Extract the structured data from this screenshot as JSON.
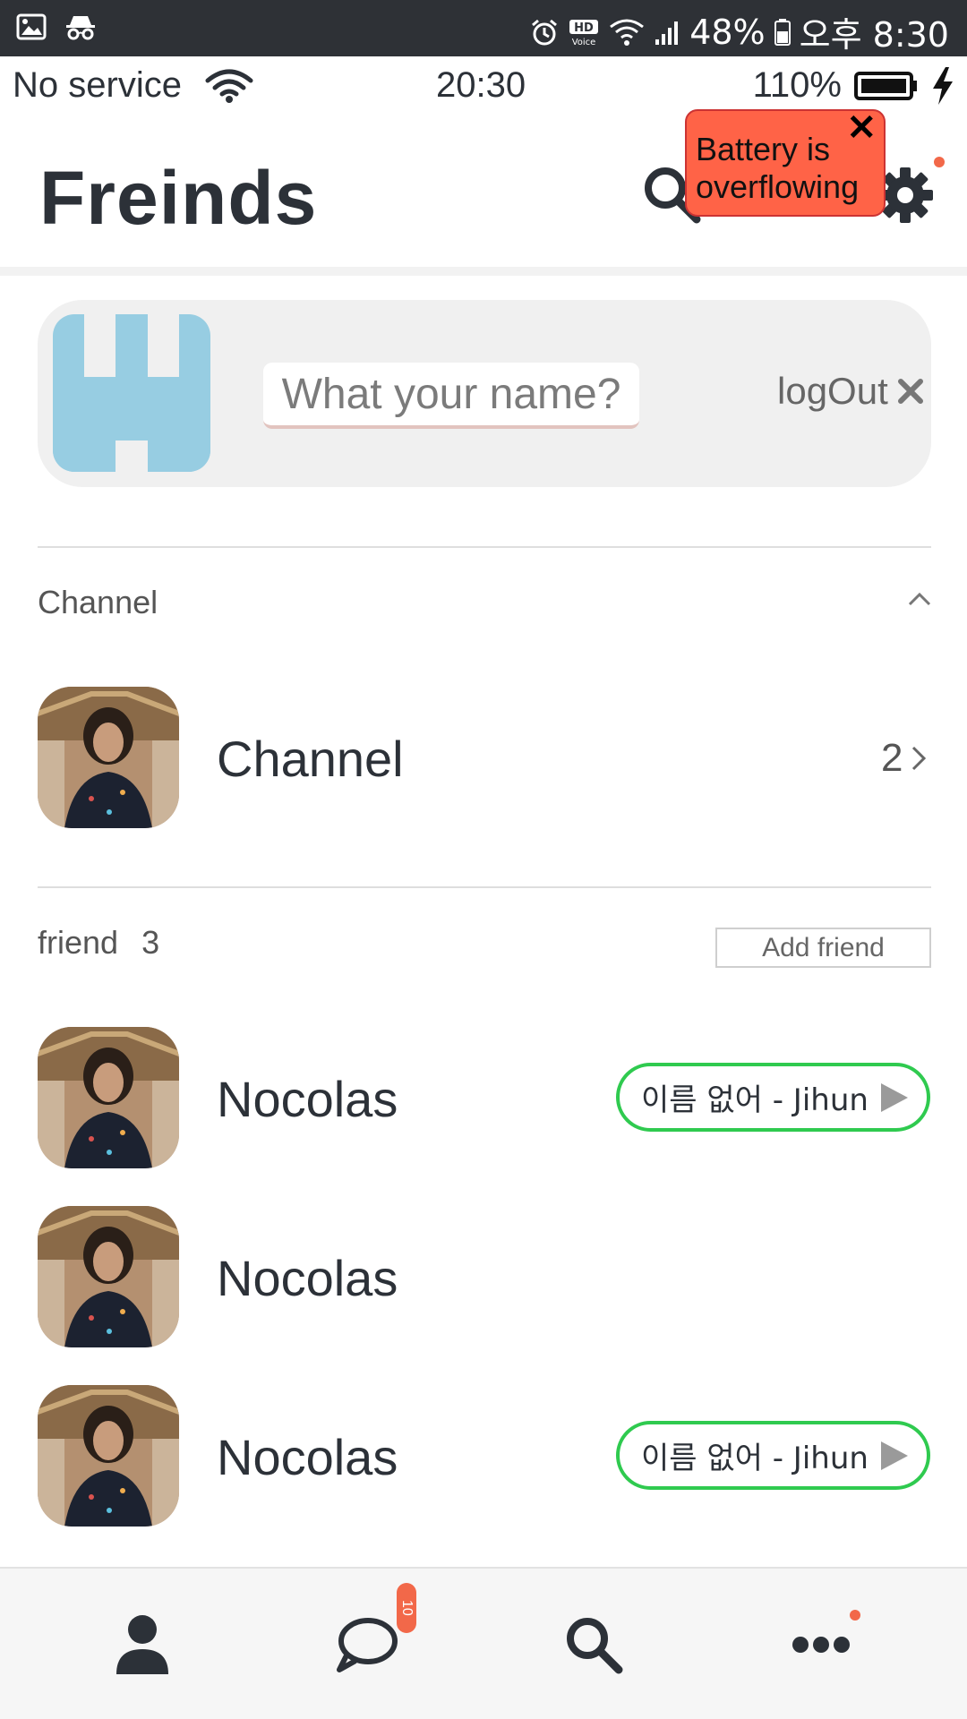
{
  "system_bar": {
    "battery": "48%",
    "time": "오후 8:30",
    "hd_voice": "HD Voice"
  },
  "app_status": {
    "service": "No service",
    "clock": "20:30",
    "battery": "110%"
  },
  "header": {
    "title": "Freinds",
    "toast": "Battery is overflowing",
    "toast_close": "✕"
  },
  "profile": {
    "name_placeholder": "What your name?",
    "logout_label": "logOut"
  },
  "channel_section": {
    "label": "Channel",
    "item_name": "Channel",
    "count": "2"
  },
  "friend_section": {
    "label": "friend",
    "count": "3",
    "add_label": "Add friend",
    "friends": [
      {
        "name": "Nocolas",
        "status": "이름 없어 - Jihun"
      },
      {
        "name": "Nocolas",
        "status": ""
      },
      {
        "name": "Nocolas",
        "status": "이름 없어 - Jihun"
      }
    ]
  },
  "bottom_nav": {
    "chat_badge": "10"
  },
  "colors": {
    "accent": "#f26849",
    "status_green": "#2fca4f",
    "toast_bg": "#ff6347",
    "identicon": "#97cde2"
  }
}
